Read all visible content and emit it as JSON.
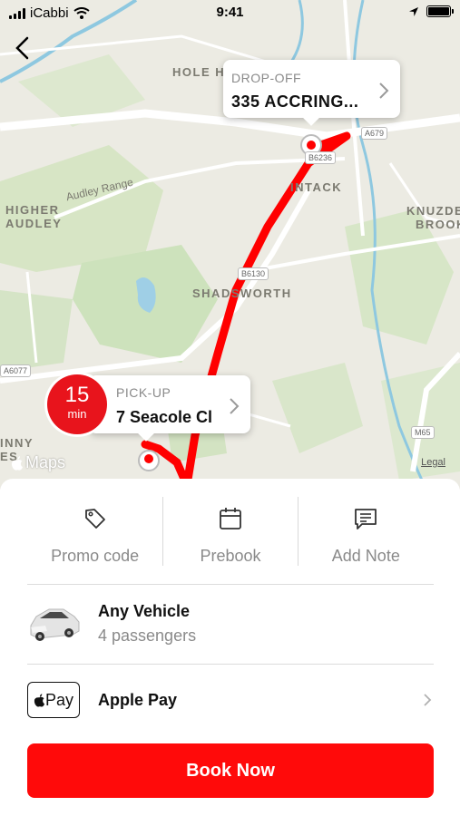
{
  "status_bar": {
    "carrier": "iCabbi",
    "time": "9:41"
  },
  "map": {
    "labels": {
      "hole_h": "HOLE H",
      "intack": "INTACK",
      "knuzden_brook_1": "KNUZDE",
      "knuzden_brook_2": "BROOK",
      "higher_audley_1": "HIGHER",
      "higher_audley_2": "AUDLEY",
      "shadsworth": "SHADSWORTH",
      "inny_1": "INNY",
      "inny_2": "ES",
      "audley_range": "Audley Range"
    },
    "shields": {
      "a679": "A679",
      "b6236": "B6236",
      "b6130": "B6130",
      "a6077": "A6077",
      "m65": "M65"
    },
    "maps_brand": "Maps",
    "legal": "Legal",
    "route_color": "#ff0000"
  },
  "dropoff": {
    "label": "DROP-OFF",
    "address": "335 ACCRING..."
  },
  "pickup": {
    "label": "PICK-UP",
    "address": "7 Seacole Cl",
    "eta_value": "15",
    "eta_unit": "min"
  },
  "options": {
    "promo_label": "Promo code",
    "prebook_label": "Prebook",
    "note_label": "Add Note"
  },
  "vehicle": {
    "name": "Any Vehicle",
    "passengers": "4 passengers"
  },
  "payment": {
    "badge": "Pay",
    "name": "Apple Pay"
  },
  "book_button": "Book Now",
  "colors": {
    "accent": "#ff0a0a",
    "eta_bubble": "#e8141c"
  }
}
